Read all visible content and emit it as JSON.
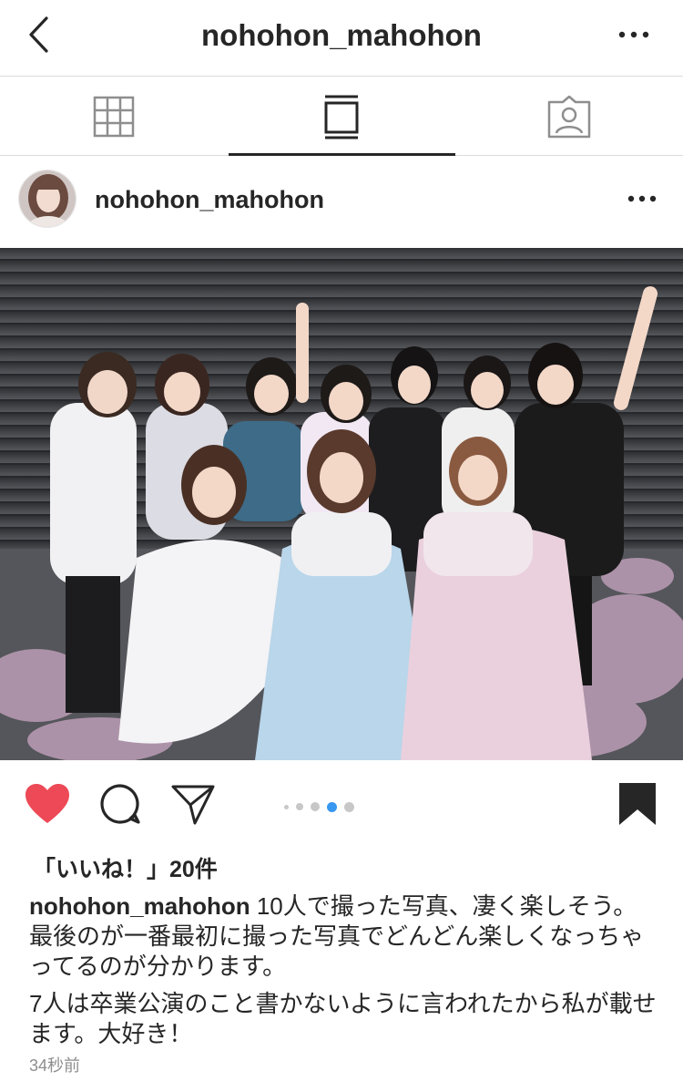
{
  "header": {
    "title": "nohohon_mahohon"
  },
  "tabs": [
    {
      "name": "grid",
      "icon": "grid-icon"
    },
    {
      "name": "feed",
      "icon": "feed-icon",
      "active": true
    },
    {
      "name": "tagged",
      "icon": "tagged-icon"
    }
  ],
  "post": {
    "username": "nohohon_mahohon",
    "likes_label": "「いいね！」20件",
    "caption_user": "nohohon_mahohon",
    "caption_line1": " 10人で撮った写真、凄く楽しそう。最後のが一番最初に撮った写真でどんどん楽しくなっちゃってるのが分かります。",
    "caption_line2": "7人は卒業公演のこと書かないように言われたから私が載せます。大好き！",
    "timestamp": "34秒前",
    "carousel": {
      "count": 5,
      "active_index": 3
    },
    "liked": true,
    "saved": true,
    "colors": {
      "heart": "#ed4956",
      "carousel_active": "#3897f0"
    }
  }
}
